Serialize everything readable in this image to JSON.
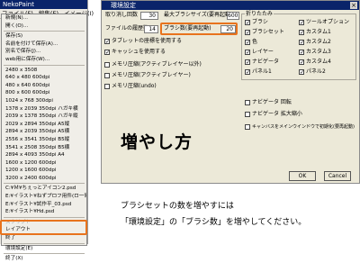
{
  "menu_window": {
    "title": "NekoPaint",
    "menubar": [
      "ファイル(F)",
      "編集(E)",
      "イメージ(I)"
    ],
    "items": [
      {
        "label": "新規(N)..."
      },
      {
        "label": "開く(O)..."
      },
      {
        "sep": true
      },
      {
        "label": "保存(S)"
      },
      {
        "label": "名前を付けて保存(A)..."
      },
      {
        "label": "別名で保存(J)..."
      },
      {
        "label": "web用に保存(W)..."
      },
      {
        "sep": true
      },
      {
        "label": "2480 x 3508"
      },
      {
        "label": "640 x 480 600dpi"
      },
      {
        "label": "480 x 640 600dpi"
      },
      {
        "label": "800 x 600 600dpi"
      },
      {
        "label": "1024 x 768 300dpi"
      },
      {
        "label": "1378 x 2039 350dpi ハガキ横"
      },
      {
        "label": "2039 x 1378 350dpi ハガキ縦"
      },
      {
        "label": "2029 x 2894 350dpi A5縦"
      },
      {
        "label": "2894 x 2039 350dpi A5横"
      },
      {
        "label": "2556 x 3541 350dpi B5縦"
      },
      {
        "label": "3541 x 2508 350dpi B5横"
      },
      {
        "label": "2894 x 4093 350dpi A4"
      },
      {
        "label": "1600 x 1200 600dpi"
      },
      {
        "label": "1200 x 1600 600dpi"
      },
      {
        "label": "3200 x 2400 600dpi"
      },
      {
        "sep": true
      },
      {
        "label": "C:¥Ｍ¥ちぇっとアイコン2.psd"
      },
      {
        "label": "E:¥イラスト¥ねずプロフ用件(ロ一哥).psd"
      },
      {
        "label": "E:¥イラスト¥試作平_03.psd"
      },
      {
        "label": "E:¥イラスト¥Hd.psd"
      },
      {
        "sep": true
      },
      {
        "label": "スクリプト",
        "disabled": true
      },
      {
        "label": "レイアウト"
      },
      {
        "label": "終了"
      },
      {
        "sep": true
      },
      {
        "label": "環境設定(E)"
      },
      {
        "sep": true
      },
      {
        "label": "終了(X)"
      }
    ]
  },
  "dialog": {
    "title": "環境設定",
    "close": "×",
    "fields": {
      "undo_label": "取り消し回数",
      "undo_value": "30",
      "maxbrush_label": "最大ブラシサイズ(要再起動)",
      "maxbrush_value": "600",
      "filehistory_label": "ファイルの履歴数",
      "filehistory_value": "14",
      "brushcount_label": "ブラシ数(要再起動)",
      "brushcount_value": "20"
    },
    "checks": [
      {
        "label": "タブレットの座標を使用する",
        "checked": true
      },
      {
        "label": "キャッシュを使用する",
        "checked": true
      },
      {
        "label": "メモリ圧縮(アクティブレイヤー以外)",
        "checked": false
      },
      {
        "label": "メモリ圧縮(アクティブレイヤー)",
        "checked": false
      },
      {
        "label": "メモリ圧縮(undo)",
        "checked": false
      }
    ],
    "fold_group": {
      "title": "折りたたみ",
      "left": [
        "ブラシ",
        "ブラシセット",
        "色",
        "レイヤー",
        "ナビゲータ",
        "パネル1"
      ],
      "right": [
        "ツールオプション",
        "カスタム1",
        "カスタム2",
        "カスタム3",
        "カスタム4",
        "パネル2"
      ]
    },
    "bottom_checks": [
      "ナビゲータ 回転",
      "ナビゲータ 拡大縮小",
      "キャンバスをメインウインドウで初期化(要再起動)"
    ],
    "ok": "OK",
    "cancel": "Cancel"
  },
  "annotation": {
    "big": "増やし方",
    "line1": "ブラシセットの数を増やすには",
    "line2": "「環境設定」の「ブラシ数」を増やしてください。"
  }
}
